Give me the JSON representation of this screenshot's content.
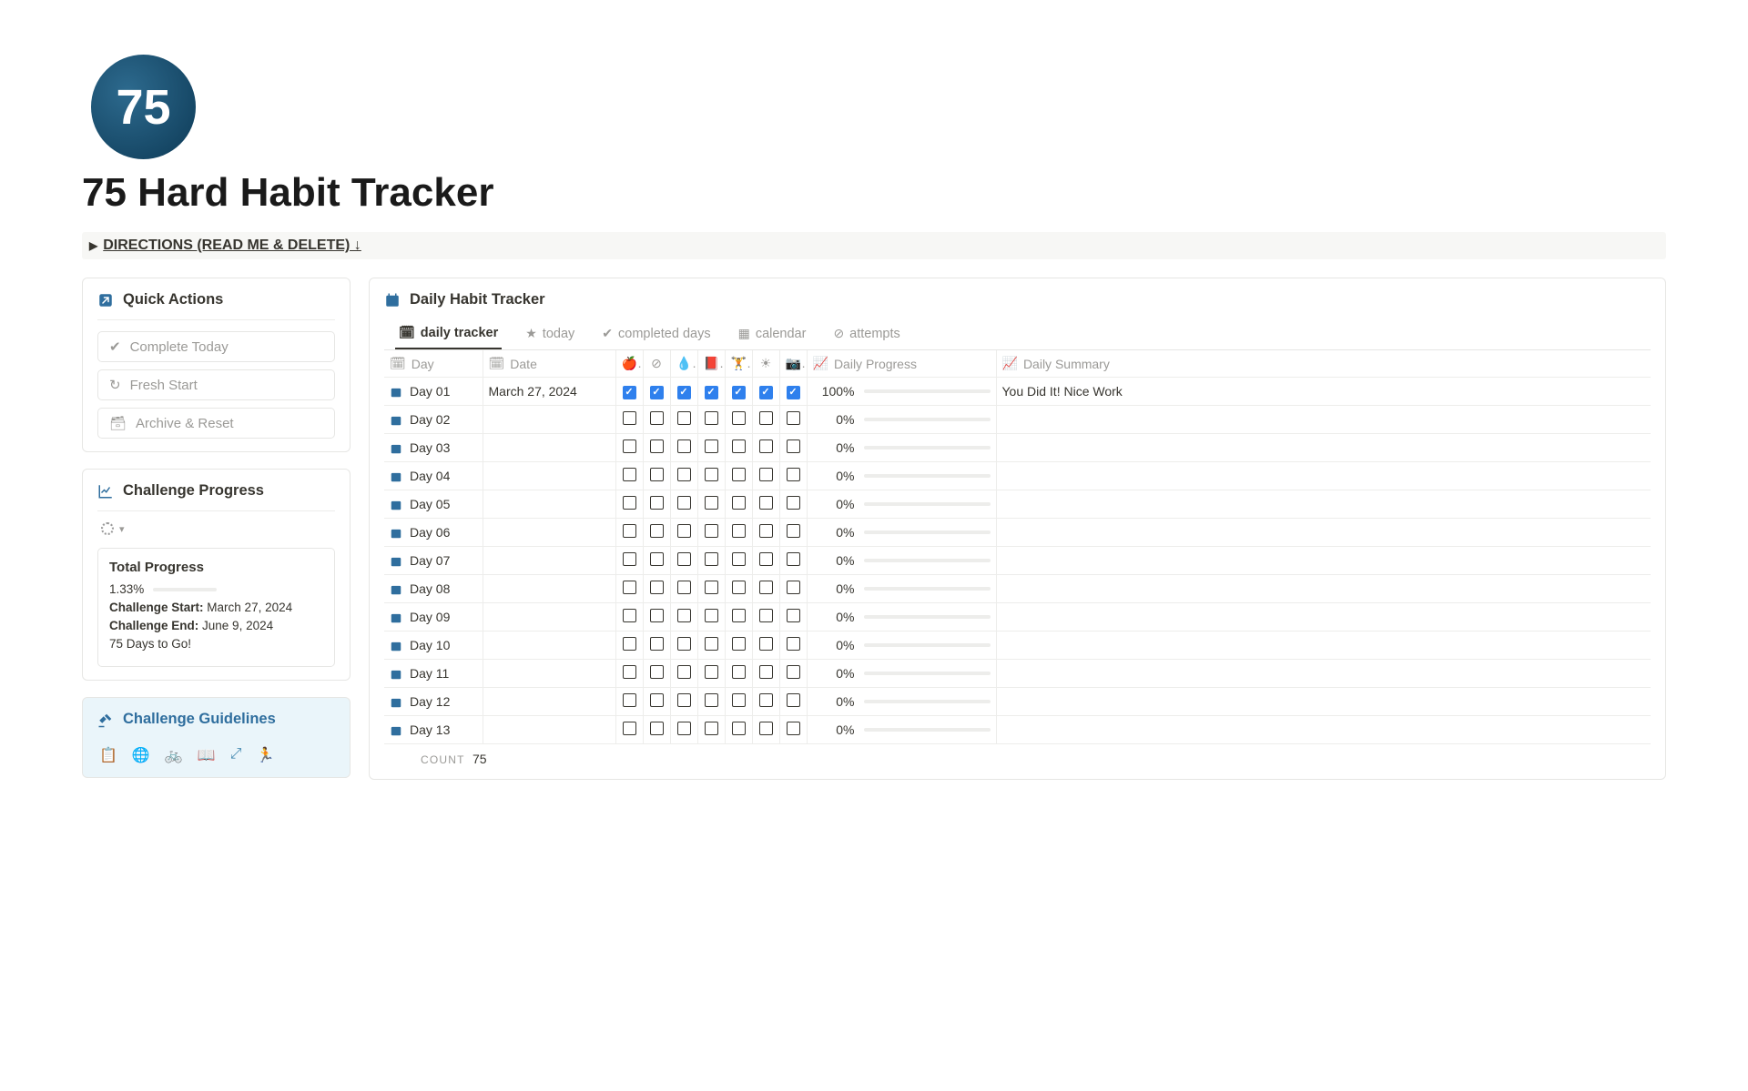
{
  "logo_text": "75",
  "page_title": "75 Hard Habit Tracker",
  "directions_toggle": "DIRECTIONS (READ ME & DELETE) ↓",
  "quick_actions": {
    "title": "Quick Actions",
    "items": [
      "Complete Today",
      "Fresh Start",
      "Archive & Reset"
    ]
  },
  "challenge_progress": {
    "title": "Challenge Progress",
    "card_title": "Total Progress",
    "percent": "1.33%",
    "percent_num": 1.33,
    "start_label": "Challenge Start:",
    "start_value": "March 27, 2024",
    "end_label": "Challenge End:",
    "end_value": "June 9, 2024",
    "days_to_go": "75 Days to Go!"
  },
  "guidelines": {
    "title": "Challenge Guidelines"
  },
  "daily": {
    "title": "Daily Habit Tracker",
    "tabs": [
      "daily tracker",
      "today",
      "completed days",
      "calendar",
      "attempts"
    ],
    "columns": {
      "day": "Day",
      "date": "Date",
      "progress": "Daily Progress",
      "summary": "Daily Summary"
    },
    "rows": [
      {
        "day": "Day 01",
        "date": "March 27, 2024",
        "checks": [
          true,
          true,
          true,
          true,
          true,
          true,
          true
        ],
        "percent": "100%",
        "pnum": 100,
        "summary": "You Did It! Nice Work"
      },
      {
        "day": "Day 02",
        "date": "",
        "checks": [
          false,
          false,
          false,
          false,
          false,
          false,
          false
        ],
        "percent": "0%",
        "pnum": 0,
        "summary": ""
      },
      {
        "day": "Day 03",
        "date": "",
        "checks": [
          false,
          false,
          false,
          false,
          false,
          false,
          false
        ],
        "percent": "0%",
        "pnum": 0,
        "summary": ""
      },
      {
        "day": "Day 04",
        "date": "",
        "checks": [
          false,
          false,
          false,
          false,
          false,
          false,
          false
        ],
        "percent": "0%",
        "pnum": 0,
        "summary": ""
      },
      {
        "day": "Day 05",
        "date": "",
        "checks": [
          false,
          false,
          false,
          false,
          false,
          false,
          false
        ],
        "percent": "0%",
        "pnum": 0,
        "summary": ""
      },
      {
        "day": "Day 06",
        "date": "",
        "checks": [
          false,
          false,
          false,
          false,
          false,
          false,
          false
        ],
        "percent": "0%",
        "pnum": 0,
        "summary": ""
      },
      {
        "day": "Day 07",
        "date": "",
        "checks": [
          false,
          false,
          false,
          false,
          false,
          false,
          false
        ],
        "percent": "0%",
        "pnum": 0,
        "summary": ""
      },
      {
        "day": "Day 08",
        "date": "",
        "checks": [
          false,
          false,
          false,
          false,
          false,
          false,
          false
        ],
        "percent": "0%",
        "pnum": 0,
        "summary": ""
      },
      {
        "day": "Day 09",
        "date": "",
        "checks": [
          false,
          false,
          false,
          false,
          false,
          false,
          false
        ],
        "percent": "0%",
        "pnum": 0,
        "summary": ""
      },
      {
        "day": "Day 10",
        "date": "",
        "checks": [
          false,
          false,
          false,
          false,
          false,
          false,
          false
        ],
        "percent": "0%",
        "pnum": 0,
        "summary": ""
      },
      {
        "day": "Day 11",
        "date": "",
        "checks": [
          false,
          false,
          false,
          false,
          false,
          false,
          false
        ],
        "percent": "0%",
        "pnum": 0,
        "summary": ""
      },
      {
        "day": "Day 12",
        "date": "",
        "checks": [
          false,
          false,
          false,
          false,
          false,
          false,
          false
        ],
        "percent": "0%",
        "pnum": 0,
        "summary": ""
      },
      {
        "day": "Day 13",
        "date": "",
        "checks": [
          false,
          false,
          false,
          false,
          false,
          false,
          false
        ],
        "percent": "0%",
        "pnum": 0,
        "summary": ""
      }
    ],
    "count_label": "COUNT",
    "count_value": "75"
  }
}
